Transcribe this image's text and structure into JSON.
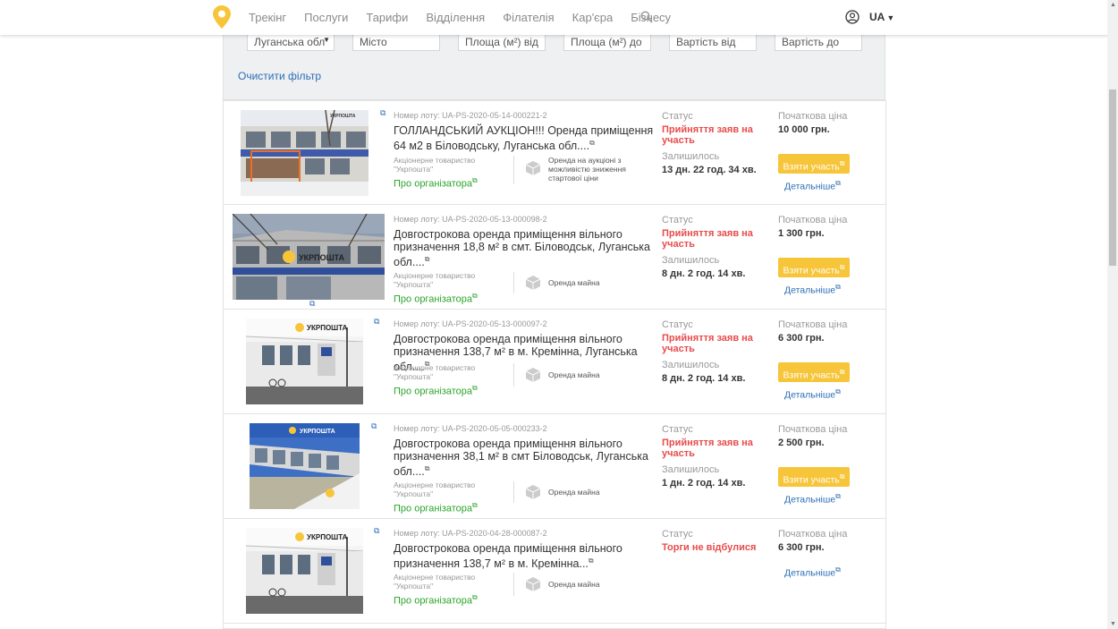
{
  "nav": {
    "links": [
      "Трекінг",
      "Послуги",
      "Тарифи",
      "Відділення",
      "Філателія",
      "Кар'єра",
      "Бізнесу"
    ],
    "lang": "UA"
  },
  "filter": {
    "region_value": "Луганська обл",
    "city_placeholder": "Місто",
    "area_from_placeholder": "Площа (м²) від",
    "area_to_placeholder": "Площа (м²) до",
    "price_from_placeholder": "Вартість від",
    "price_to_placeholder": "Вартість до",
    "clear_label": "Очистити фільтр"
  },
  "labels": {
    "status": "Статус",
    "time_left": "Залишилось",
    "start_price": "Початкова ціна",
    "participate": "Взяти участь",
    "details": "Детальніше",
    "org_line1": "Акціонерне товариство",
    "org_line2": "\"Укрпошта\"",
    "org_link": "Про організатора",
    "lot_prefix": "Номер лоту: "
  },
  "lots": [
    {
      "lot_number": "UA-PS-2020-05-14-000221-2",
      "title": "ГОЛЛАНДСЬКИЙ АУКЦІОН!!! Оренда приміщення 64 м2 в Біловодську, Луганська обл....",
      "auction_type": "Оренда на аукціоні з можливістю зниження стартової ціни",
      "status": "Прийняття заяв на участь",
      "time_left": "13 дн. 22 год. 34 хв.",
      "price": "10 000 грн."
    },
    {
      "lot_number": "UA-PS-2020-05-13-000098-2",
      "title": "Довгострокова оренда приміщення вільного призначення 18,8 м² в смт. Біловодськ, Луганська обл....",
      "auction_type": "Оренда майна",
      "status": "Прийняття заяв на участь",
      "time_left": "8 дн. 2 год. 14 хв.",
      "price": "1 300 грн."
    },
    {
      "lot_number": "UA-PS-2020-05-13-000097-2",
      "title": "Довгострокова оренда приміщення вільного призначення 138,7 м² в м. Кремінна, Луганська обл....",
      "auction_type": "Оренда майна",
      "status": "Прийняття заяв на участь",
      "time_left": "8 дн. 2 год. 14 хв.",
      "price": "6 300 грн."
    },
    {
      "lot_number": "UA-PS-2020-05-05-000233-2",
      "title": "Довгострокова оренда приміщення вільного призначення 38,1 м² в смт Біловодськ, Луганська обл....",
      "auction_type": "Оренда майна",
      "status": "Прийняття заяв на участь",
      "time_left": "1 дн. 2 год. 14 хв.",
      "price": "2 500 грн."
    },
    {
      "lot_number": "UA-PS-2020-04-28-000087-2",
      "title": "Довгострокова оренда приміщення вільного призначення 138,7 м² в м. Кремінна...",
      "auction_type": "Оренда майна",
      "status": "Торги не відбулися",
      "time_left": "",
      "price": "6 300 грн."
    }
  ],
  "thumb_watermark": "УКРПОШТА",
  "colors": {
    "accent_yellow": "#f7c53a",
    "status_red": "#e94b4b",
    "link_blue": "#2d6db5",
    "org_green": "#2aa52a"
  }
}
